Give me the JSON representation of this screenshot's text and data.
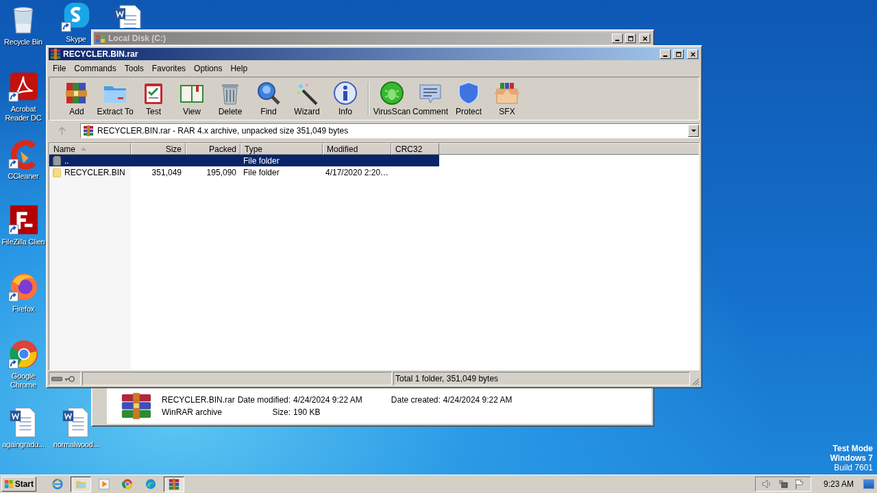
{
  "desktop_icons": [
    {
      "label": "Recycle Bin",
      "kind": "recycle"
    },
    {
      "label": "Skype",
      "kind": "skype"
    },
    {
      "label": "Acrobat Reader DC",
      "kind": "acrobat"
    },
    {
      "label": "CCleaner",
      "kind": "ccleaner"
    },
    {
      "label": "FileZilla Clien",
      "kind": "filezilla"
    },
    {
      "label": "Firefox",
      "kind": "firefox"
    },
    {
      "label": "Google Chrome",
      "kind": "chrome"
    },
    {
      "label": "againgradu...",
      "kind": "word"
    },
    {
      "label": "normalwood...",
      "kind": "word"
    },
    {
      "kind": "word"
    }
  ],
  "background_window": {
    "title": "Local Disk (C:)",
    "details": {
      "name": "RECYCLER.BIN.rar",
      "type": "WinRAR archive",
      "properties": [
        {
          "label": "Date modified:",
          "value": "4/24/2024 9:22 AM"
        },
        {
          "label": "Size:",
          "value": "190 KB"
        },
        {
          "label": "Date created:",
          "value": "4/24/2024 9:22 AM"
        }
      ]
    }
  },
  "window": {
    "title": "RECYCLER.BIN.rar",
    "menu": [
      "File",
      "Commands",
      "Tools",
      "Favorites",
      "Options",
      "Help"
    ],
    "toolbar": [
      {
        "label": "Add",
        "kind": "add"
      },
      {
        "label": "Extract To",
        "kind": "extract"
      },
      {
        "label": "Test",
        "kind": "test"
      },
      {
        "label": "View",
        "kind": "view"
      },
      {
        "label": "Delete",
        "kind": "delete"
      },
      {
        "label": "Find",
        "kind": "find"
      },
      {
        "label": "Wizard",
        "kind": "wizard"
      },
      {
        "label": "Info",
        "kind": "info"
      },
      {
        "kind": "separator"
      },
      {
        "label": "VirusScan",
        "kind": "virusscan"
      },
      {
        "label": "Comment",
        "kind": "comment"
      },
      {
        "label": "Protect",
        "kind": "protect"
      },
      {
        "label": "SFX",
        "kind": "sfx"
      }
    ],
    "path": "RECYCLER.BIN.rar - RAR 4.x archive, unpacked size 351,049 bytes",
    "columns": [
      {
        "label": "Name",
        "sorted": true
      },
      {
        "label": "Size",
        "sorted": false
      },
      {
        "label": "Packed",
        "sorted": false
      },
      {
        "label": "Type",
        "sorted": false
      },
      {
        "label": "Modified",
        "sorted": false
      },
      {
        "label": "CRC32",
        "sorted": false
      }
    ],
    "rows": [
      {
        "kind": "parent",
        "name": "..",
        "type": "File folder",
        "selected": true
      },
      {
        "kind": "folder",
        "name": "RECYCLER.BIN",
        "size": "351,049",
        "packed": "195,090",
        "type": "File folder",
        "modified": "4/17/2020 2:20…",
        "selected": false
      }
    ],
    "status": "Total 1 folder, 351,049 bytes"
  },
  "system_text": [
    "Test Mode",
    "Windows 7",
    "Build 7601"
  ],
  "taskbar": {
    "start": "Start",
    "apps": [
      {
        "kind": "ie",
        "active": false
      },
      {
        "kind": "explorer",
        "active": true
      },
      {
        "kind": "media",
        "active": false
      },
      {
        "kind": "chrome",
        "active": false
      },
      {
        "kind": "edge",
        "active": false
      },
      {
        "kind": "winrar",
        "active": true
      }
    ],
    "clock": "9:23 AM"
  }
}
